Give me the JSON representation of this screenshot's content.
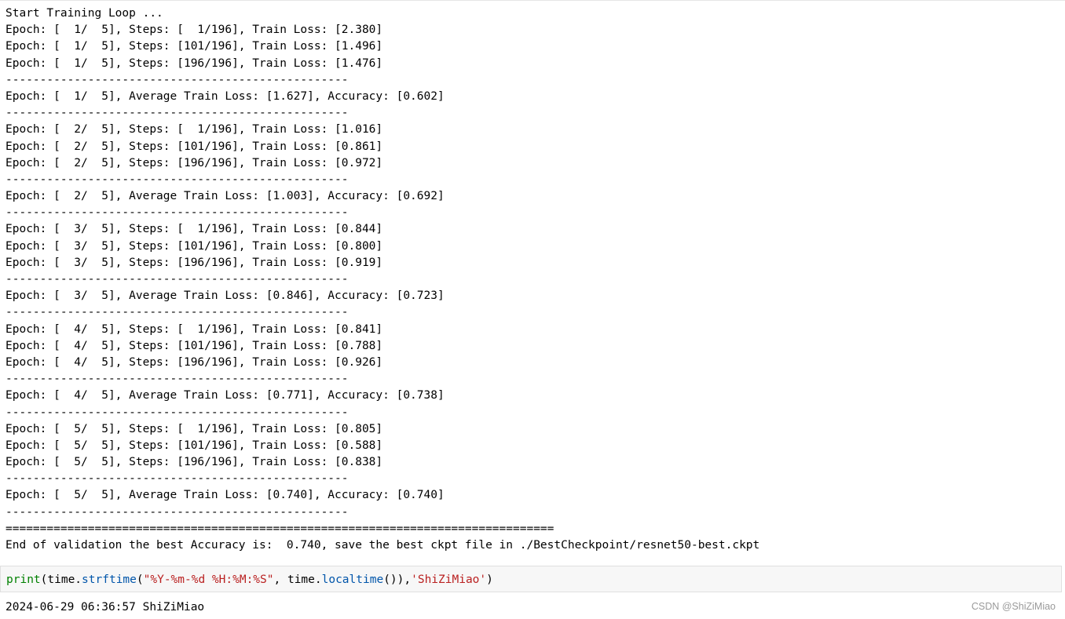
{
  "output": {
    "lines": [
      "Start Training Loop ...",
      "Epoch: [  1/  5], Steps: [  1/196], Train Loss: [2.380]",
      "Epoch: [  1/  5], Steps: [101/196], Train Loss: [1.496]",
      "Epoch: [  1/  5], Steps: [196/196], Train Loss: [1.476]",
      "--------------------------------------------------",
      "Epoch: [  1/  5], Average Train Loss: [1.627], Accuracy: [0.602]",
      "--------------------------------------------------",
      "Epoch: [  2/  5], Steps: [  1/196], Train Loss: [1.016]",
      "Epoch: [  2/  5], Steps: [101/196], Train Loss: [0.861]",
      "Epoch: [  2/  5], Steps: [196/196], Train Loss: [0.972]",
      "--------------------------------------------------",
      "Epoch: [  2/  5], Average Train Loss: [1.003], Accuracy: [0.692]",
      "--------------------------------------------------",
      "Epoch: [  3/  5], Steps: [  1/196], Train Loss: [0.844]",
      "Epoch: [  3/  5], Steps: [101/196], Train Loss: [0.800]",
      "Epoch: [  3/  5], Steps: [196/196], Train Loss: [0.919]",
      "--------------------------------------------------",
      "Epoch: [  3/  5], Average Train Loss: [0.846], Accuracy: [0.723]",
      "--------------------------------------------------",
      "Epoch: [  4/  5], Steps: [  1/196], Train Loss: [0.841]",
      "Epoch: [  4/  5], Steps: [101/196], Train Loss: [0.788]",
      "Epoch: [  4/  5], Steps: [196/196], Train Loss: [0.926]",
      "--------------------------------------------------",
      "Epoch: [  4/  5], Average Train Loss: [0.771], Accuracy: [0.738]",
      "--------------------------------------------------",
      "Epoch: [  5/  5], Steps: [  1/196], Train Loss: [0.805]",
      "Epoch: [  5/  5], Steps: [101/196], Train Loss: [0.588]",
      "Epoch: [  5/  5], Steps: [196/196], Train Loss: [0.838]",
      "--------------------------------------------------",
      "Epoch: [  5/  5], Average Train Loss: [0.740], Accuracy: [0.740]",
      "--------------------------------------------------",
      "================================================================================",
      "End of validation the best Accuracy is:  0.740, save the best ckpt file in ./BestCheckpoint/resnet50-best.ckpt"
    ]
  },
  "code_cell": {
    "tokens": [
      {
        "text": "print",
        "kind": "builtin"
      },
      {
        "text": "(time.",
        "kind": "punct"
      },
      {
        "text": "strftime",
        "kind": "attr"
      },
      {
        "text": "(",
        "kind": "punct"
      },
      {
        "text": "\"%Y-%m-%d %H:%M:%S\"",
        "kind": "str"
      },
      {
        "text": ", time.",
        "kind": "punct"
      },
      {
        "text": "localtime",
        "kind": "attr"
      },
      {
        "text": "()),",
        "kind": "punct"
      },
      {
        "text": "'ShiZiMiao'",
        "kind": "str"
      },
      {
        "text": ")",
        "kind": "punct"
      }
    ]
  },
  "result": {
    "text": "2024-06-29 06:36:57 ShiZiMiao"
  },
  "watermark": {
    "text": "CSDN @ShiZiMiao"
  }
}
